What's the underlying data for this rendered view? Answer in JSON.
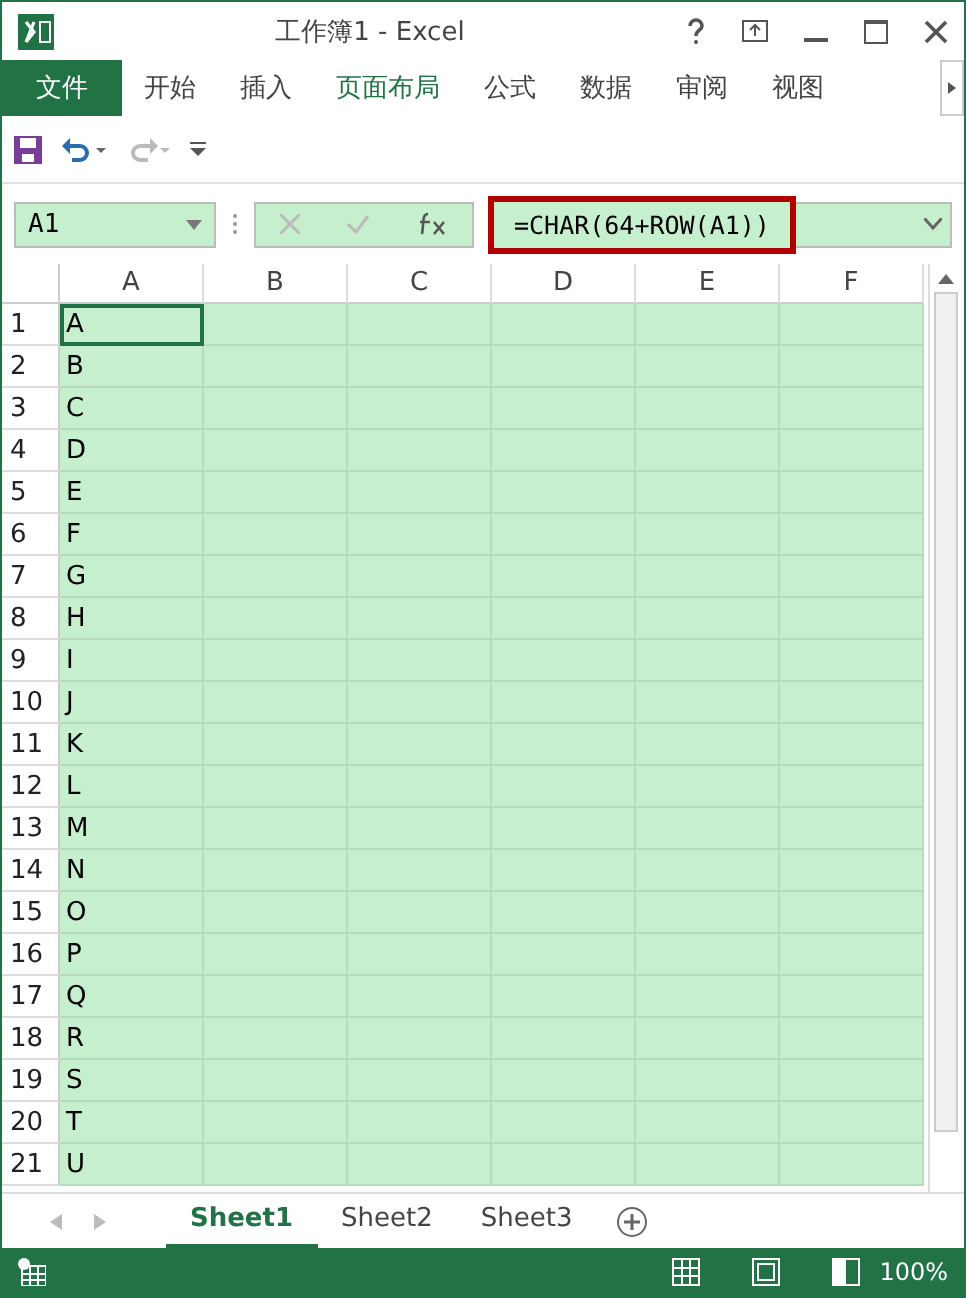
{
  "window": {
    "title": "工作簿1 - Excel"
  },
  "ribbon_tabs": [
    {
      "label": "文件",
      "kind": "file"
    },
    {
      "label": "开始",
      "kind": "tab",
      "selected": false
    },
    {
      "label": "插入",
      "kind": "tab",
      "selected": false
    },
    {
      "label": "页面布局",
      "kind": "tab",
      "selected": true
    },
    {
      "label": "公式",
      "kind": "tab",
      "selected": false
    },
    {
      "label": "数据",
      "kind": "tab",
      "selected": false
    },
    {
      "label": "审阅",
      "kind": "tab",
      "selected": false
    },
    {
      "label": "视图",
      "kind": "tab",
      "selected": false
    }
  ],
  "formula_bar": {
    "name_box": "A1",
    "formula": "=CHAR(64+ROW(A1))"
  },
  "sheet": {
    "columns": [
      "A",
      "B",
      "C",
      "D",
      "E",
      "F"
    ],
    "rows": [
      {
        "number": "1",
        "a": "A",
        "selected": true
      },
      {
        "number": "2",
        "a": "B",
        "selected": false
      },
      {
        "number": "3",
        "a": "C",
        "selected": false
      },
      {
        "number": "4",
        "a": "D",
        "selected": false
      },
      {
        "number": "5",
        "a": "E",
        "selected": false
      },
      {
        "number": "6",
        "a": "F",
        "selected": false
      },
      {
        "number": "7",
        "a": "G",
        "selected": false
      },
      {
        "number": "8",
        "a": "H",
        "selected": false
      },
      {
        "number": "9",
        "a": "I",
        "selected": false
      },
      {
        "number": "10",
        "a": "J",
        "selected": false
      },
      {
        "number": "11",
        "a": "K",
        "selected": false
      },
      {
        "number": "12",
        "a": "L",
        "selected": false
      },
      {
        "number": "13",
        "a": "M",
        "selected": false
      },
      {
        "number": "14",
        "a": "N",
        "selected": false
      },
      {
        "number": "15",
        "a": "O",
        "selected": false
      },
      {
        "number": "16",
        "a": "P",
        "selected": false
      },
      {
        "number": "17",
        "a": "Q",
        "selected": false
      },
      {
        "number": "18",
        "a": "R",
        "selected": false
      },
      {
        "number": "19",
        "a": "S",
        "selected": false
      },
      {
        "number": "20",
        "a": "T",
        "selected": false
      },
      {
        "number": "21",
        "a": "U",
        "selected": false
      }
    ]
  },
  "sheet_tabs": [
    {
      "label": "Sheet1",
      "selected": true
    },
    {
      "label": "Sheet2",
      "selected": false
    },
    {
      "label": "Sheet3",
      "selected": false
    }
  ],
  "status_bar": {
    "zoom": "100%"
  }
}
